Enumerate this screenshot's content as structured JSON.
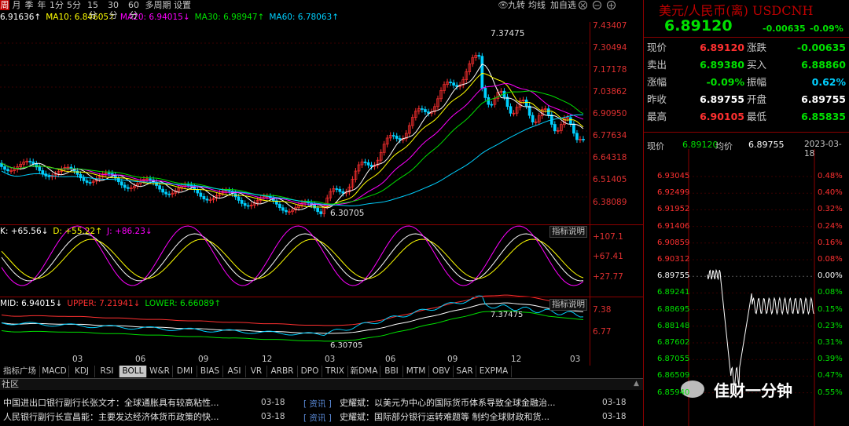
{
  "period_tabs": [
    "周",
    "月",
    "季",
    "年",
    "1分",
    "5分",
    "15分",
    "30分",
    "60分",
    "多周期",
    "设置"
  ],
  "active_period": "周",
  "top_right": {
    "tab1": "九转",
    "tab2": "均线",
    "tab3": "加自选",
    "icons": [
      "eye-icon",
      "cross-circle-icon",
      "minus-circle-icon",
      "plus-circle-icon"
    ]
  },
  "ma_legend": [
    {
      "text": "6.91636↑",
      "color": "#ffffff"
    },
    {
      "text": "MA10: 6.84605↑",
      "color": "#ffff00"
    },
    {
      "text": "MA20: 6.94015↓",
      "color": "#ff00ff"
    },
    {
      "text": "MA30: 6.98947↑",
      "color": "#00e000"
    },
    {
      "text": "MA60: 6.78063↑",
      "color": "#00d0ff"
    }
  ],
  "main_yaxis": [
    "7.43407",
    "7.30494",
    "7.17178",
    "7.03862",
    "6.90950",
    "6.77634",
    "6.64318",
    "6.51405",
    "6.38089"
  ],
  "annotations": {
    "high": "7.37475",
    "low": "6.30705"
  },
  "kdj_legend": [
    {
      "text": "K: +65.56↓",
      "color": "#ffffff"
    },
    {
      "text": "D: +55.22↑",
      "color": "#ffff00"
    },
    {
      "text": "J: +86.23↓",
      "color": "#ff00ff"
    }
  ],
  "kdj_yaxis": [
    "+107.1",
    "+67.41",
    "+27.77"
  ],
  "boll_legend": [
    {
      "text": "MID: 6.94015↓",
      "color": "#ffffff"
    },
    {
      "text": "UPPER: 7.21941↓",
      "color": "#ff3030"
    },
    {
      "text": "LOWER: 6.66089↑",
      "color": "#00e000"
    }
  ],
  "boll_yaxis": [
    "7.38",
    "6.77"
  ],
  "boll_annotations": {
    "high": "7.37475",
    "low": "6.30705"
  },
  "explain_label": "指标说明",
  "xaxis": [
    "03",
    "06",
    "09",
    "12",
    "03",
    "06",
    "09",
    "12",
    "03"
  ],
  "indicator_tabs": [
    "指标广场",
    "MACD",
    "KDJ",
    "RSI",
    "BOLL",
    "W&R",
    "DMI",
    "BIAS",
    "ASI",
    "VR",
    "ARBR",
    "DPO",
    "TRIX",
    "EXPMA",
    "BBI",
    "MTM",
    "OBV",
    "SAR",
    "EXPMA"
  ],
  "indicator_tabs_fixed": [
    "指标广场",
    "MACD",
    "KDJ",
    "RSI",
    "BOLL",
    "W&R",
    "DMI",
    "BIAS",
    "ASI",
    "VR",
    "ARBR",
    "DPO",
    "TRIX",
    "新DMA",
    "BBI",
    "MTM",
    "OBV",
    "SAR",
    "EXPMA"
  ],
  "active_indicator": "BOLL",
  "news_header": "社区",
  "news": [
    {
      "text": "中国进出口银行副行长张文才：全球通胀具有较高粘性...",
      "date": "03-18",
      "tag": "资讯",
      "text2": "史耀斌：以美元为中心的国际货币体系导致全球金融治...",
      "date2": "03-18"
    },
    {
      "text": "人民银行副行长宣昌能：主要发达经济体货币政策的快...",
      "date": "03-18",
      "tag": "资讯",
      "text2": "史耀斌：国际部分银行运转难题等 制约全球财政和货...",
      "date2": "03-18"
    }
  ],
  "quote": {
    "title": "美元/人民币(离) USDCNH",
    "price": "6.89120",
    "change": "-0.00635",
    "change_pct": "-0.09%",
    "rows": [
      {
        "l1": "现价",
        "v1": "6.89120",
        "c1": "#ff3030",
        "l2": "涨跌",
        "v2": "-0.00635",
        "c2": "#00e000"
      },
      {
        "l1": "卖出",
        "v1": "6.89380",
        "c1": "#00e000",
        "l2": "买入",
        "v2": "6.88860",
        "c2": "#00e000"
      },
      {
        "l1": "涨幅",
        "v1": "-0.09%",
        "c1": "#00e000",
        "l2": "振幅",
        "v2": "0.62%",
        "c2": "#00d0ff"
      },
      {
        "l1": "昨收",
        "v1": "6.89755",
        "c1": "#ffffff",
        "l2": "开盘",
        "v2": "6.89755",
        "c2": "#ffffff"
      },
      {
        "l1": "最高",
        "v1": "6.90105",
        "c1": "#ff3030",
        "l2": "最低",
        "v2": "6.85835",
        "c2": "#00e000"
      }
    ]
  },
  "intraday": {
    "label_price": "现价",
    "price": "6.89120",
    "label_avg": "均价",
    "avg": "6.89755",
    "date": "2023-03-18",
    "left_axis": [
      "6.93045",
      "6.92499",
      "6.91952",
      "6.91406",
      "6.90859",
      "6.90312",
      "6.89755",
      "6.89241",
      "6.88695",
      "6.88148",
      "6.87602",
      "6.87055",
      "6.86509",
      "6.85940"
    ],
    "right_axis": [
      "0.48%",
      "0.40%",
      "0.32%",
      "0.24%",
      "0.16%",
      "0.08%",
      "0.00%",
      "0.08%",
      "0.15%",
      "0.23%",
      "0.31%",
      "0.39%",
      "0.47%",
      "0.55%"
    ]
  },
  "watermark": "佳财一分钟"
}
